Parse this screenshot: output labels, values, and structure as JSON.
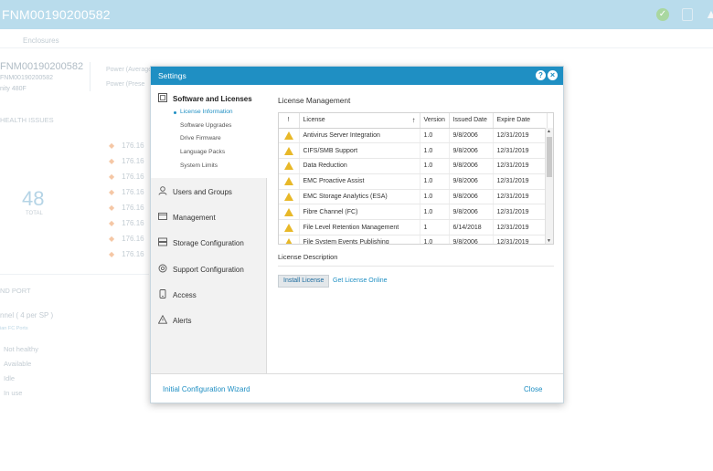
{
  "app": {
    "title": "FNM00190200582",
    "tab": "Enclosures",
    "system_name": "FNM00190200582",
    "system_serial": "FNM00190200582",
    "system_model": "nity 480F",
    "power_avg": "Power (Average",
    "power_present": "Power (Prese",
    "health_title": "HEALTH ISSUES",
    "total_count": "48",
    "total_label": "TOTAL",
    "ip_prefix": "176.16",
    "port_title": "ND PORT",
    "channel_text": "nnel ( 4 per SP )",
    "fc_link": "ian FC Ports",
    "legend": [
      "Not healthy",
      "Available",
      "Idle",
      "In use"
    ],
    "colors": {
      "header": "#b9dcec",
      "accent": "#1f8fc3",
      "warning": "#e8b828"
    },
    "icons": [
      "check-circle-icon",
      "document-icon",
      "alert-icon"
    ]
  },
  "dialog": {
    "title": "Settings",
    "help_glyph": "?",
    "close_glyph": "×",
    "sidebar": {
      "items": [
        {
          "label": "Software and Licenses",
          "icon": "software-icon"
        },
        {
          "label": "Users and Groups",
          "icon": "users-icon"
        },
        {
          "label": "Management",
          "icon": "management-icon"
        },
        {
          "label": "Storage Configuration",
          "icon": "storage-icon"
        },
        {
          "label": "Support Configuration",
          "icon": "support-icon"
        },
        {
          "label": "Access",
          "icon": "access-icon"
        },
        {
          "label": "Alerts",
          "icon": "alert-triangle-icon"
        }
      ],
      "subitems": [
        "License Information",
        "Software Upgrades",
        "Drive Firmware",
        "Language Packs",
        "System Limits"
      ]
    },
    "section_title": "License Management",
    "table": {
      "headers": [
        "!",
        "License",
        "Version",
        "Issued Date",
        "Expire Date"
      ],
      "sort_glyph": "↑",
      "rows": [
        {
          "license": "Antivirus Server Integration",
          "version": "1.0",
          "issued": "9/8/2006",
          "expire": "12/31/2019"
        },
        {
          "license": "CIFS/SMB Support",
          "version": "1.0",
          "issued": "9/8/2006",
          "expire": "12/31/2019"
        },
        {
          "license": "Data Reduction",
          "version": "1.0",
          "issued": "9/8/2006",
          "expire": "12/31/2019"
        },
        {
          "license": "EMC Proactive Assist",
          "version": "1.0",
          "issued": "9/8/2006",
          "expire": "12/31/2019"
        },
        {
          "license": "EMC Storage Analytics (ESA)",
          "version": "1.0",
          "issued": "9/8/2006",
          "expire": "12/31/2019"
        },
        {
          "license": "Fibre Channel (FC)",
          "version": "1.0",
          "issued": "9/8/2006",
          "expire": "12/31/2019"
        },
        {
          "license": "File Level Retention Management",
          "version": "1",
          "issued": "6/14/2018",
          "expire": "12/31/2019"
        },
        {
          "license": "File System Events Publishing",
          "version": "1.0",
          "issued": "9/8/2006",
          "expire": "12/31/2019"
        }
      ]
    },
    "description_title": "License Description",
    "install_label": "Install License",
    "get_online_label": "Get License Online",
    "wizard_label": "Initial Configuration Wizard",
    "close_label": "Close"
  }
}
